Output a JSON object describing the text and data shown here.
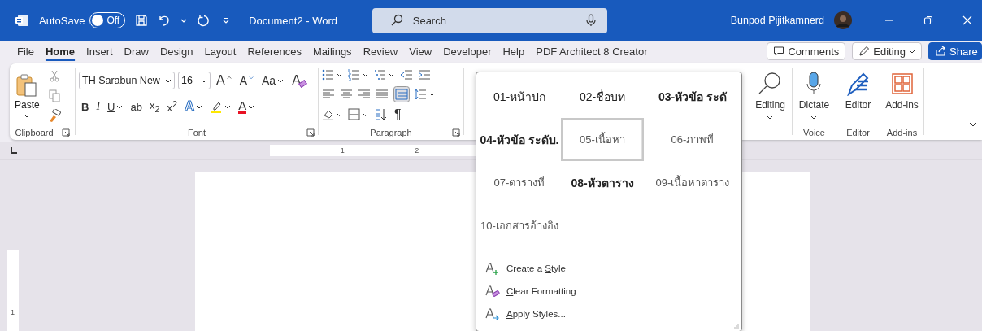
{
  "title_bar": {
    "autosave_label": "AutoSave",
    "autosave": {
      "on": false,
      "label": "Off"
    },
    "document_title": "Document2  -  Word",
    "search": {
      "placeholder": "Search"
    },
    "user_name": "Bunpod Pijitkamnerd"
  },
  "tabs": [
    {
      "label": "File",
      "selected": false
    },
    {
      "label": "Home",
      "selected": true
    },
    {
      "label": "Insert",
      "selected": false
    },
    {
      "label": "Draw",
      "selected": false
    },
    {
      "label": "Design",
      "selected": false
    },
    {
      "label": "Layout",
      "selected": false
    },
    {
      "label": "References",
      "selected": false
    },
    {
      "label": "Mailings",
      "selected": false
    },
    {
      "label": "Review",
      "selected": false
    },
    {
      "label": "View",
      "selected": false
    },
    {
      "label": "Developer",
      "selected": false
    },
    {
      "label": "Help",
      "selected": false
    },
    {
      "label": "PDF Architect 8 Creator",
      "selected": false
    }
  ],
  "top_buttons": {
    "comments": "Comments",
    "editing": "Editing",
    "share": "Share"
  },
  "ribbon": {
    "clipboard": {
      "paste": "Paste",
      "label": "Clipboard"
    },
    "font": {
      "name": "TH Sarabun New",
      "size": "16",
      "grow": "A",
      "shrink": "A",
      "case": "Aa",
      "clear": "A",
      "label": "Font",
      "format": [
        {
          "label": "B",
          "kind": "bold",
          "caret": false
        },
        {
          "label": "I",
          "kind": "italic",
          "caret": false
        },
        {
          "label": "U",
          "kind": "underline",
          "caret": true
        },
        {
          "label": "ab",
          "kind": "strike",
          "caret": false
        },
        {
          "label": "x$_{2}$",
          "kind": "sub",
          "caret": false
        },
        {
          "label": "x$^{2}$",
          "kind": "sup",
          "caret": false
        },
        {
          "label": "A",
          "kind": "effects",
          "caret": true
        },
        {
          "kind": "highlight",
          "caret": true
        },
        {
          "label": "A",
          "kind": "color",
          "caret": true
        }
      ]
    },
    "paragraph": {
      "label": "Paragraph",
      "marks": "¶"
    },
    "editing": {
      "label": "Editing"
    },
    "voice": {
      "button": "Dictate",
      "label": "Voice"
    },
    "editor": {
      "button": "Editor",
      "label": "Editor"
    },
    "addins": {
      "button": "Add-ins",
      "label": "Add-ins"
    }
  },
  "ruler": {
    "marks": [
      "1",
      "2"
    ],
    "vertical_marks": [
      "1"
    ]
  },
  "styles_menu": {
    "styles": [
      {
        "label": "01-หน้าปก",
        "bold": false,
        "muted": false,
        "selected": false
      },
      {
        "label": "02-ชื่อบท",
        "bold": false,
        "muted": false,
        "selected": false
      },
      {
        "label": "03-หัวข้อ ระดั",
        "bold": true,
        "muted": false,
        "selected": false
      },
      {
        "label": "04-หัวข้อ ระดับ.",
        "bold": true,
        "muted": false,
        "selected": false
      },
      {
        "label": "05-เนื้อหา",
        "bold": false,
        "muted": true,
        "selected": true
      },
      {
        "label": "06-ภาพที่",
        "bold": false,
        "muted": true,
        "selected": false
      },
      {
        "label": "07-ตารางที่",
        "bold": false,
        "muted": true,
        "selected": false
      },
      {
        "label": "08-หัวตาราง",
        "bold": true,
        "muted": false,
        "selected": false
      },
      {
        "label": "09-เนื้อหาตาราง",
        "bold": false,
        "muted": true,
        "selected": false
      },
      {
        "label": "10-เอกสารอ้างอิง",
        "bold": false,
        "muted": true,
        "selected": false
      }
    ],
    "actions": [
      {
        "kind": "create",
        "before": "Create a ",
        "key": "S",
        "after": "tyle"
      },
      {
        "kind": "clear",
        "key": "C",
        "after": "lear Formatting"
      },
      {
        "kind": "apply",
        "key": "A",
        "after": "pply Styles..."
      }
    ]
  }
}
